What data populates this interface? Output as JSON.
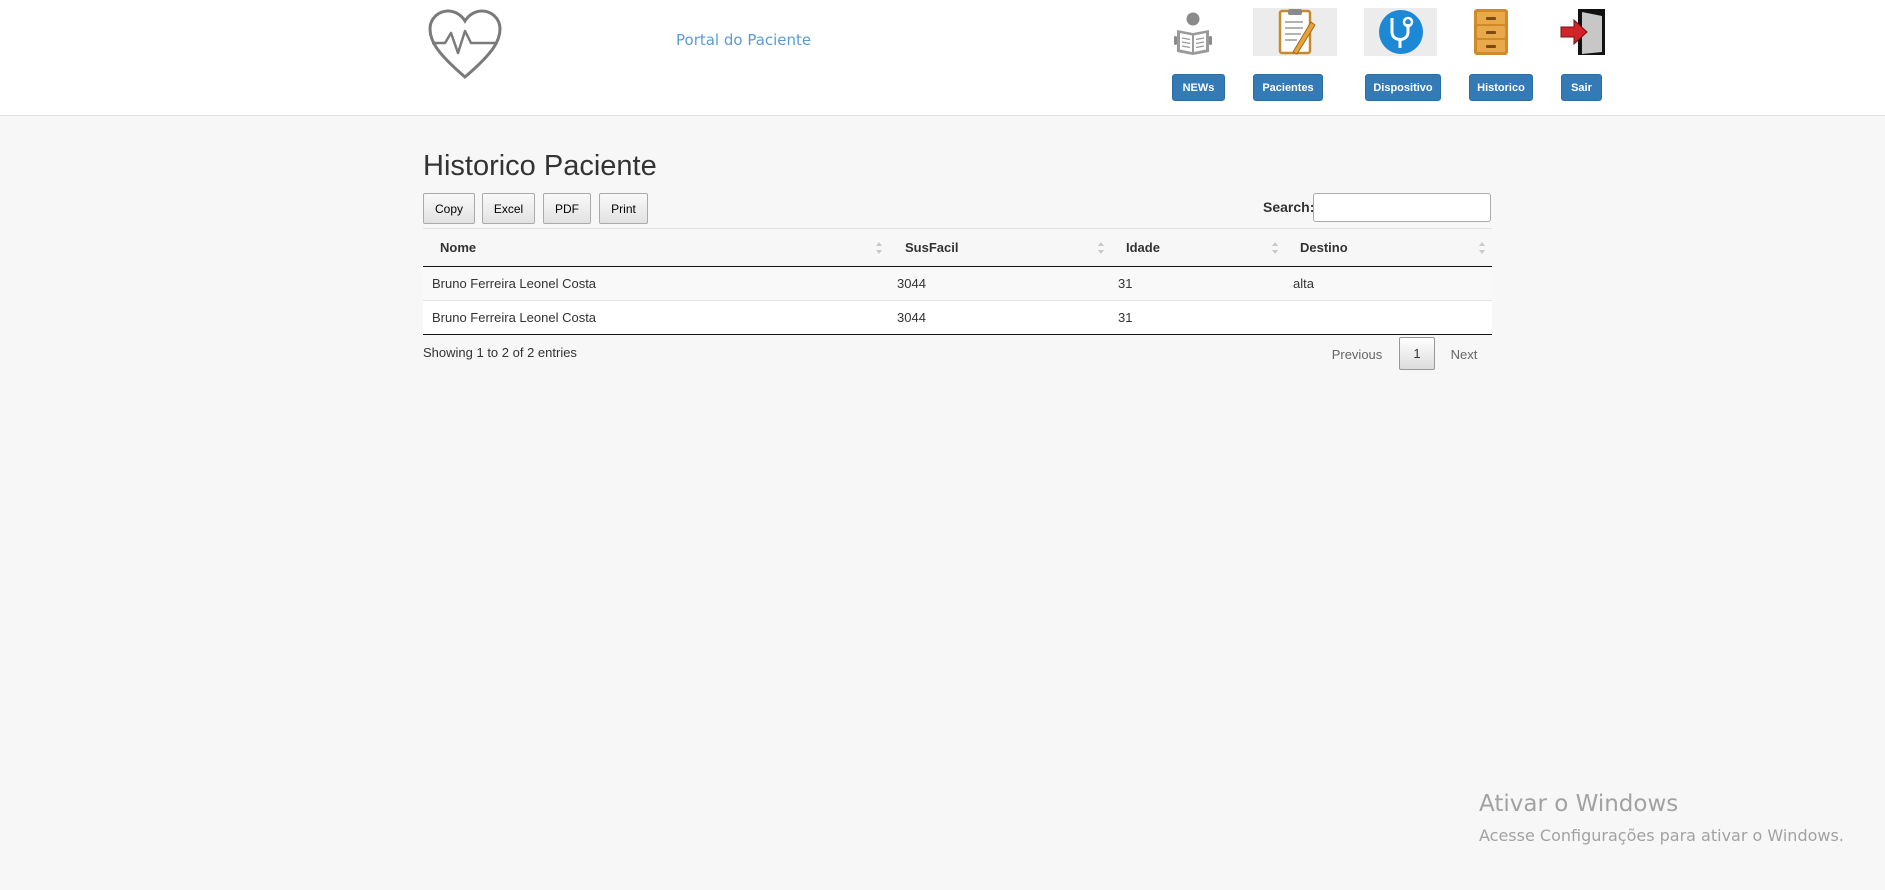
{
  "header": {
    "portal_title": "Portal do Paciente",
    "nav": [
      {
        "label": "NEWs",
        "icon": "news-reader-icon"
      },
      {
        "label": "Pacientes",
        "icon": "clipboard-icon"
      },
      {
        "label": "Dispositivo",
        "icon": "stethoscope-icon"
      },
      {
        "label": "Historico",
        "icon": "file-cabinet-icon"
      },
      {
        "label": "Sair",
        "icon": "exit-door-icon"
      }
    ],
    "accent_color": "#337ab7"
  },
  "main": {
    "title": "Historico Paciente",
    "toolbar": {
      "copy": "Copy",
      "excel": "Excel",
      "pdf": "PDF",
      "print": "Print"
    },
    "search": {
      "label": "Search:",
      "value": ""
    },
    "table": {
      "columns": [
        "Nome",
        "SusFacil",
        "Idade",
        "Destino"
      ],
      "rows": [
        [
          "Bruno Ferreira Leonel Costa",
          "3044",
          "31",
          "alta"
        ],
        [
          "Bruno Ferreira Leonel Costa",
          "3044",
          "31",
          ""
        ]
      ]
    },
    "info": "Showing 1 to 2 of 2 entries",
    "pagination": {
      "previous": "Previous",
      "current": "1",
      "next": "Next"
    }
  },
  "watermark": {
    "title": "Ativar o Windows",
    "subtitle": "Acesse Configurações para ativar o Windows."
  }
}
